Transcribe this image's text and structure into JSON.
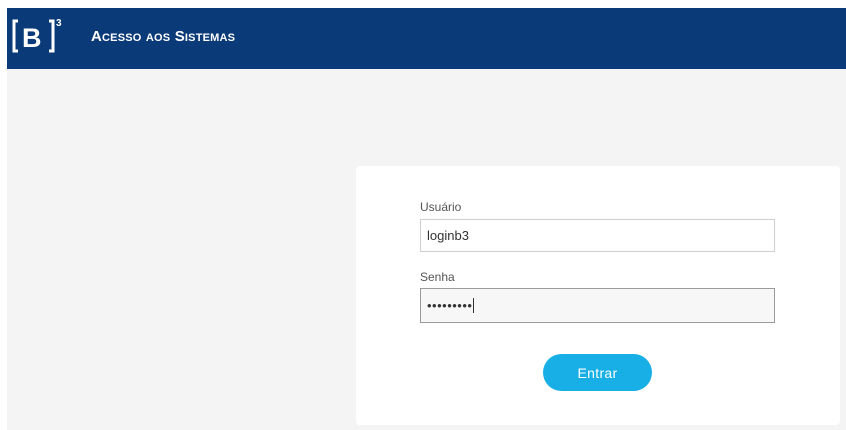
{
  "header": {
    "logo_text": "B",
    "logo_superscript": "3",
    "title": "Acesso aos Sistemas",
    "background_color": "#0b3a78"
  },
  "login": {
    "username_label": "Usuário",
    "username_value": "loginb3",
    "password_label": "Senha",
    "password_masked": "•••••••••",
    "submit_label": "Entrar",
    "button_color": "#18aee6"
  },
  "page": {
    "background_color": "#f4f4f4"
  }
}
